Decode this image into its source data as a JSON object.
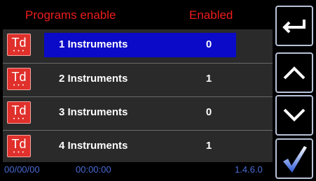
{
  "header": {
    "title": "Programs enable",
    "status_label": "Enabled"
  },
  "colors": {
    "header_text": "#ee1c1c",
    "selection": "#0a0ac8",
    "footer_text": "#4a6bd6",
    "icon_red": "#e0302b"
  },
  "programs": [
    {
      "icon_text": "Td",
      "icon_dots": "• • •",
      "label": "1 Instruments",
      "value": "0",
      "selected": true
    },
    {
      "icon_text": "Td",
      "icon_dots": "• • •",
      "label": "2 Instruments",
      "value": "1",
      "selected": false
    },
    {
      "icon_text": "Td",
      "icon_dots": "• • •",
      "label": "3 Instruments",
      "value": "0",
      "selected": false
    },
    {
      "icon_text": "Td",
      "icon_dots": "• • •",
      "label": "4 Instruments",
      "value": "1",
      "selected": false
    }
  ],
  "side_buttons": {
    "back": {
      "icon": "back-arrow-icon"
    },
    "up": {
      "icon": "chevron-up-icon"
    },
    "down": {
      "icon": "chevron-down-icon"
    },
    "confirm": {
      "icon": "checkmark-icon"
    }
  },
  "footer": {
    "date": "00/00/00",
    "time": "00:00:00",
    "version": "1.4.6.0"
  }
}
